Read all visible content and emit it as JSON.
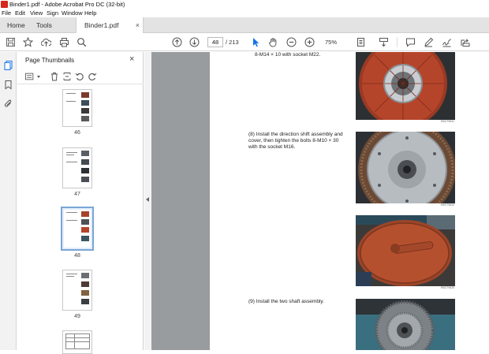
{
  "window": {
    "title": "Binder1.pdf - Adobe Acrobat Pro DC (32-bit)"
  },
  "menu": [
    "File",
    "Edit",
    "View",
    "Sign",
    "Window",
    "Help"
  ],
  "tabs": {
    "home": "Home",
    "tools": "Tools",
    "document": "Binder1.pdf",
    "close": "×"
  },
  "toolbar": {
    "current_page": "48",
    "total_pages": "/ 213",
    "zoom": "75%",
    "icons": [
      "save-icon",
      "bookmark-star-icon",
      "upload-icon",
      "print-icon",
      "search-icon",
      "prev-page-icon",
      "next-page-icon",
      "select-pointer-icon",
      "hand-icon",
      "zoom-out-icon",
      "zoom-in-icon",
      "fit-page-icon",
      "scroll-mode-icon",
      "comment-icon",
      "pen-icon",
      "sign-icon",
      "share-icon"
    ]
  },
  "panel": {
    "title": "Page Thumbnails",
    "close": "×",
    "thumbnails": [
      {
        "label": "46",
        "selected": false
      },
      {
        "label": "47",
        "selected": false
      },
      {
        "label": "48",
        "selected": true
      },
      {
        "label": "49",
        "selected": false
      },
      {
        "label": "",
        "selected": false
      }
    ]
  },
  "document": {
    "text_top": "8-M14 × 10 with socket M22.",
    "step8": "(8)  Install the direction shift assembly and cover, then tighten the bolts 8-M10 × 30 with the socket M16.",
    "step9": "(9)  Install the two shaft assembly."
  },
  "colors": {
    "accent": "#1473e6",
    "title_icon": "#d6271a",
    "rust": "#b5452a",
    "doc_bg": "#999c9f"
  }
}
